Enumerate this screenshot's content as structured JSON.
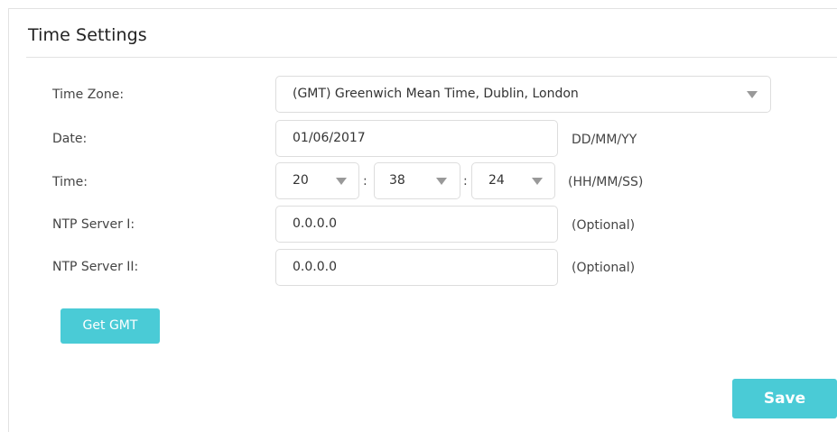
{
  "panel": {
    "title": "Time Settings"
  },
  "form": {
    "time_zone": {
      "label": "Time Zone:",
      "value": "(GMT) Greenwich Mean Time, Dublin, London"
    },
    "date": {
      "label": "Date:",
      "value": "01/06/2017",
      "format_hint": "DD/MM/YY"
    },
    "time": {
      "label": "Time:",
      "hours": "20",
      "minutes": "38",
      "seconds": "24",
      "separator": ":",
      "format_hint": "(HH/MM/SS)"
    },
    "ntp1": {
      "label": "NTP Server I:",
      "value": "0.0.0.0",
      "hint": "(Optional)"
    },
    "ntp2": {
      "label": "NTP Server II:",
      "value": "0.0.0.0",
      "hint": "(Optional)"
    }
  },
  "buttons": {
    "get_gmt": "Get GMT",
    "save": "Save"
  },
  "colors": {
    "accent": "#4acbd6",
    "border": "#dddddd",
    "arrow": "#999999"
  },
  "icons": {
    "dropdown": "chevron-down-icon"
  }
}
